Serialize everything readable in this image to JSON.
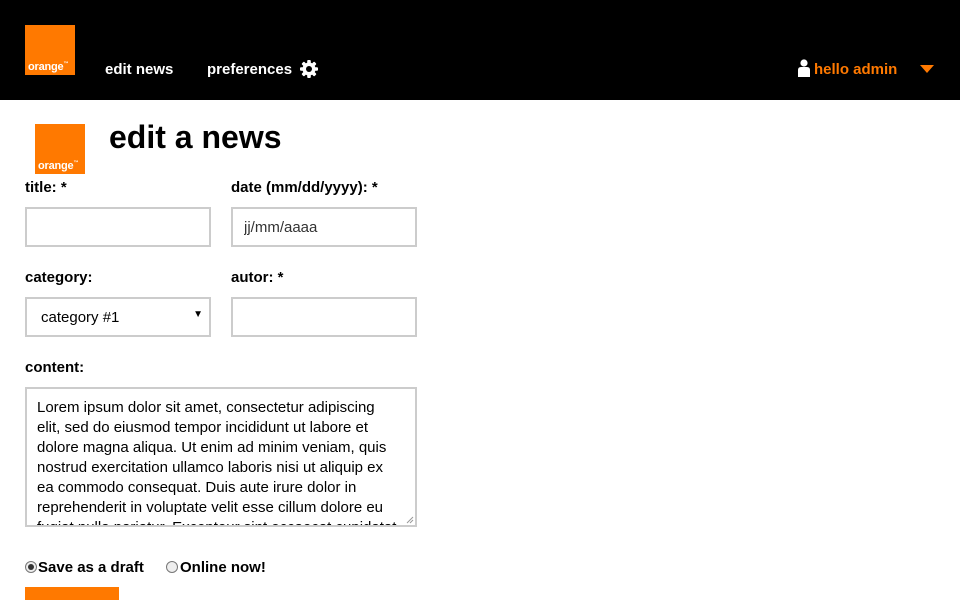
{
  "brand": {
    "logo_text": "orange",
    "accent": "#ff7900"
  },
  "nav": {
    "items": [
      {
        "label": "edit news"
      },
      {
        "label": "preferences"
      }
    ],
    "user_label": "hello admin"
  },
  "page": {
    "title": "edit a news"
  },
  "form": {
    "title": {
      "label": "title: *",
      "value": ""
    },
    "date": {
      "label": "date (mm/dd/yyyy): *",
      "placeholder": "jj/mm/aaaa"
    },
    "category": {
      "label": "category:",
      "selected": "category #1"
    },
    "author": {
      "label": "autor: *",
      "value": ""
    },
    "content": {
      "label": "content:",
      "value": "Lorem ipsum dolor sit amet, consectetur adipiscing elit, sed do eiusmod tempor incididunt ut labore et dolore magna aliqua. Ut enim ad minim veniam, quis nostrud exercitation ullamco laboris nisi ut aliquip ex ea commodo consequat. Duis aute irure dolor in reprehenderit in voluptate velit esse cillum dolore eu fugiat nulla pariatur. Excepteur sint occaecat cupidatat non proident, sunt in culpa qui officia deserunt mollit anim id est laborum."
    },
    "status": {
      "options": [
        {
          "label": "Save as a draft",
          "checked": true
        },
        {
          "label": "Online now!",
          "checked": false
        }
      ]
    }
  }
}
